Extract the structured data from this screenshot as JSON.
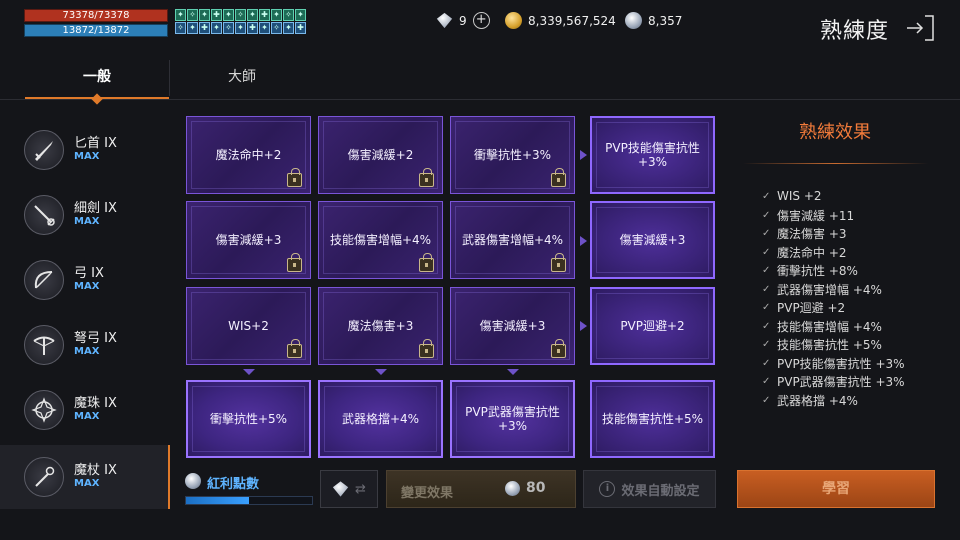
{
  "status": {
    "hp": "73378/73378",
    "mp": "13872/13872"
  },
  "currency": {
    "diamond": "9",
    "gold": "8,339,567,524",
    "silver": "8,357"
  },
  "page_title": "熟練度",
  "tabs": [
    {
      "label": "一般"
    },
    {
      "label": "大師"
    }
  ],
  "weapons": [
    {
      "name": "匕首 IX",
      "level": "MAX"
    },
    {
      "name": "細劍 IX",
      "level": "MAX"
    },
    {
      "name": "弓 IX",
      "level": "MAX"
    },
    {
      "name": "弩弓 IX",
      "level": "MAX"
    },
    {
      "name": "魔珠 IX",
      "level": "MAX"
    },
    {
      "name": "魔杖 IX",
      "level": "MAX"
    }
  ],
  "grid": [
    [
      "魔法命中+2",
      "傷害減緩+2",
      "衝擊抗性+3%",
      "PVP技能傷害抗性+3%"
    ],
    [
      "傷害減緩+3",
      "技能傷害增幅+4%",
      "武器傷害增幅+4%",
      "傷害減緩+3"
    ],
    [
      "WIS+2",
      "魔法傷害+3",
      "傷害減緩+3",
      "PVP迴避+2"
    ],
    [
      "衝擊抗性+5%",
      "武器格擋+4%",
      "PVP武器傷害抗性+3%",
      "技能傷害抗性+5%"
    ]
  ],
  "effects": {
    "title": "熟練效果",
    "items": [
      "WIS +2",
      "傷害減緩 +11",
      "魔法傷害 +3",
      "魔法命中 +2",
      "衝擊抗性 +8%",
      "武器傷害增幅 +4%",
      "PVP迴避 +2",
      "技能傷害增幅 +4%",
      "技能傷害抗性 +5%",
      "PVP技能傷害抗性 +3%",
      "PVP武器傷害抗性 +3%",
      "武器格擋 +4%"
    ]
  },
  "bonus": {
    "label": "紅利點數",
    "progress": 0.5
  },
  "actions": {
    "change_label": "變更效果",
    "change_cost": "80",
    "auto_label": "效果自動設定",
    "learn_label": "學習"
  }
}
